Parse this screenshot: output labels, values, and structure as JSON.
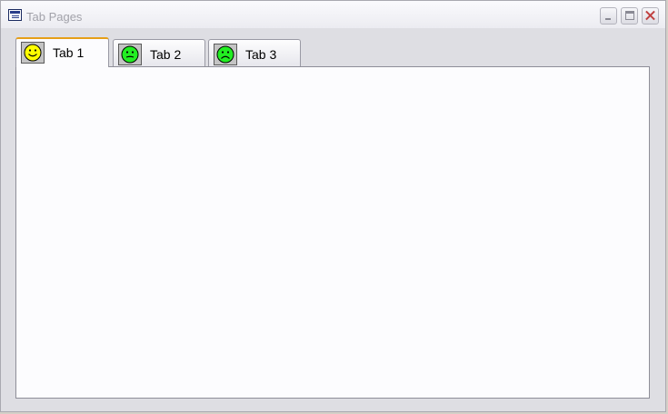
{
  "window": {
    "title": "Tab Pages"
  },
  "tabs": [
    {
      "label": "Tab 1",
      "icon": "smiley-happy-icon",
      "color": "#ffff00",
      "selected": true
    },
    {
      "label": "Tab 2",
      "icon": "smiley-neutral-icon",
      "color": "#22ee22",
      "selected": false
    },
    {
      "label": "Tab 3",
      "icon": "smiley-sad-icon",
      "color": "#22ee22",
      "selected": false
    }
  ],
  "colors": {
    "active_tab_accent": "#e69f18",
    "panel_background": "#fcfcfe"
  }
}
